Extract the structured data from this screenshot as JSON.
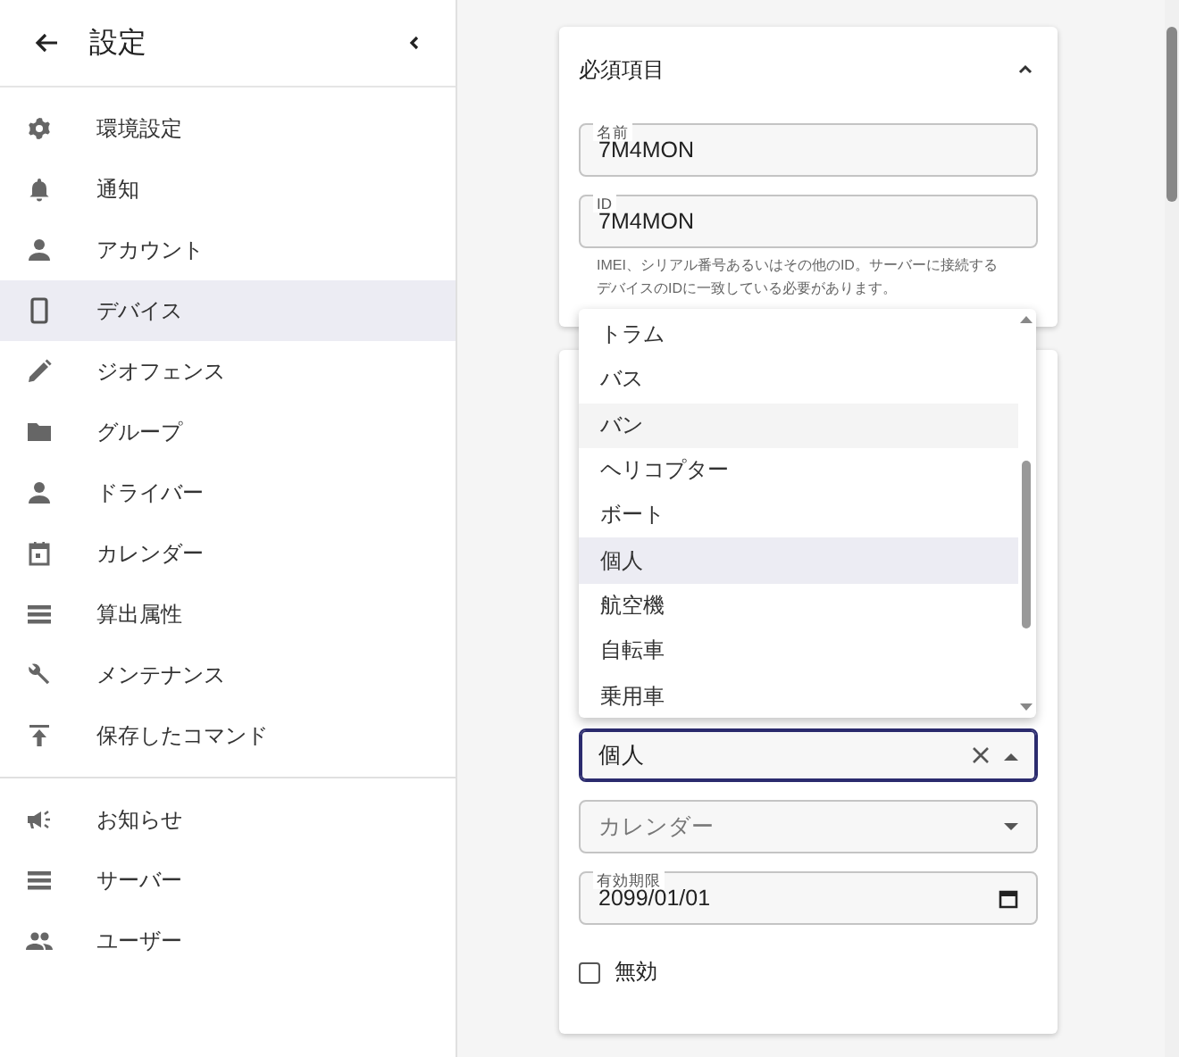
{
  "sidebar": {
    "title": "設定",
    "items": [
      {
        "label": "環境設定",
        "kind": "gear",
        "selected": false
      },
      {
        "label": "通知",
        "kind": "bell",
        "selected": false
      },
      {
        "label": "アカウント",
        "kind": "person",
        "selected": false
      },
      {
        "label": "デバイス",
        "kind": "phone",
        "selected": true
      },
      {
        "label": "ジオフェンス",
        "kind": "pencil",
        "selected": false
      },
      {
        "label": "グループ",
        "kind": "folder",
        "selected": false
      },
      {
        "label": "ドライバー",
        "kind": "person",
        "selected": false
      },
      {
        "label": "カレンダー",
        "kind": "calendar",
        "selected": false
      },
      {
        "label": "算出属性",
        "kind": "list",
        "selected": false
      },
      {
        "label": "メンテナンス",
        "kind": "wrench",
        "selected": false
      },
      {
        "label": "保存したコマンド",
        "kind": "upload",
        "selected": false
      }
    ],
    "admin_items": [
      {
        "label": "お知らせ",
        "kind": "megaphone",
        "selected": false
      },
      {
        "label": "サーバー",
        "kind": "list",
        "selected": false
      },
      {
        "label": "ユーザー",
        "kind": "people",
        "selected": false
      }
    ]
  },
  "required_section": {
    "title": "必須項目",
    "expanded": true,
    "fields": [
      {
        "label": "名前",
        "value": "7M4MON"
      },
      {
        "label": "ID",
        "value": "7M4MON",
        "helper": "IMEI、シリアル番号あるいはその他のID。サーバーに接続するデバイスのIDに一致している必要があります。"
      }
    ]
  },
  "extra_section": {
    "category": {
      "value": "個人",
      "focused": true,
      "open": true
    },
    "calendar": {
      "placeholder": "カレンダー"
    },
    "expiration": {
      "label": "有効期限",
      "value": "2099/01/01"
    },
    "disabled": {
      "label": "無効",
      "checked": false
    }
  },
  "category_options": [
    {
      "label": "トラム",
      "selected": false,
      "highlighted": false
    },
    {
      "label": "バス",
      "selected": false,
      "highlighted": false
    },
    {
      "label": "バン",
      "selected": false,
      "highlighted": true
    },
    {
      "label": "ヘリコプター",
      "selected": false,
      "highlighted": false
    },
    {
      "label": "ボート",
      "selected": false,
      "highlighted": false
    },
    {
      "label": "個人",
      "selected": true,
      "highlighted": false
    },
    {
      "label": "航空機",
      "selected": false,
      "highlighted": false
    },
    {
      "label": "自転車",
      "selected": false,
      "highlighted": false
    },
    {
      "label": "乗用車",
      "selected": false,
      "highlighted": false
    }
  ]
}
